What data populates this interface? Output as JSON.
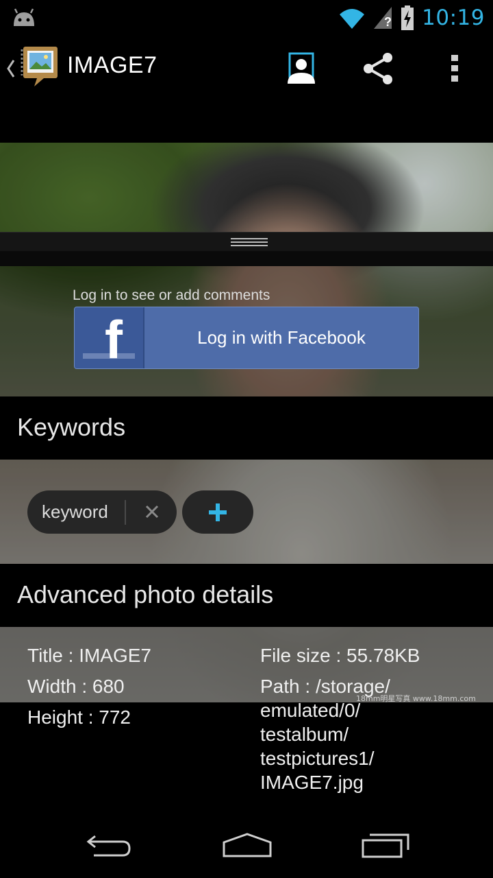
{
  "status_bar": {
    "time": "10:19",
    "icons": [
      "android-icon",
      "wifi-icon",
      "signal-unknown-icon",
      "battery-charging-icon"
    ]
  },
  "action_bar": {
    "title": "IMAGE7",
    "icons": [
      "up-caret-icon",
      "app-photo-icon",
      "person-tag-icon",
      "share-icon",
      "overflow-menu-icon"
    ]
  },
  "comments": {
    "hint": "Log in to see or add comments",
    "facebook_button_label": "Log in with Facebook"
  },
  "keywords": {
    "heading": "Keywords",
    "chips": [
      "keyword"
    ],
    "add_icon": "plus-icon",
    "remove_icon": "close-icon"
  },
  "details": {
    "heading": "Advanced photo details",
    "title_line": "Title : IMAGE7",
    "width_line": "Width : 680",
    "height_line": "Height : 772",
    "filesize_line": "File size : 55.78KB",
    "path_lines": [
      "Path : /storage/",
      "emulated/0/",
      "testalbum/",
      "testpictures1/",
      "IMAGE7.jpg"
    ],
    "watermark": "18mm明星写真 www.18mm.com"
  },
  "nav_bar": {
    "icons": [
      "back-icon",
      "home-icon",
      "recents-icon"
    ]
  },
  "colors": {
    "accent": "#33b5e5",
    "facebook_blue": "#4e6ca9"
  }
}
